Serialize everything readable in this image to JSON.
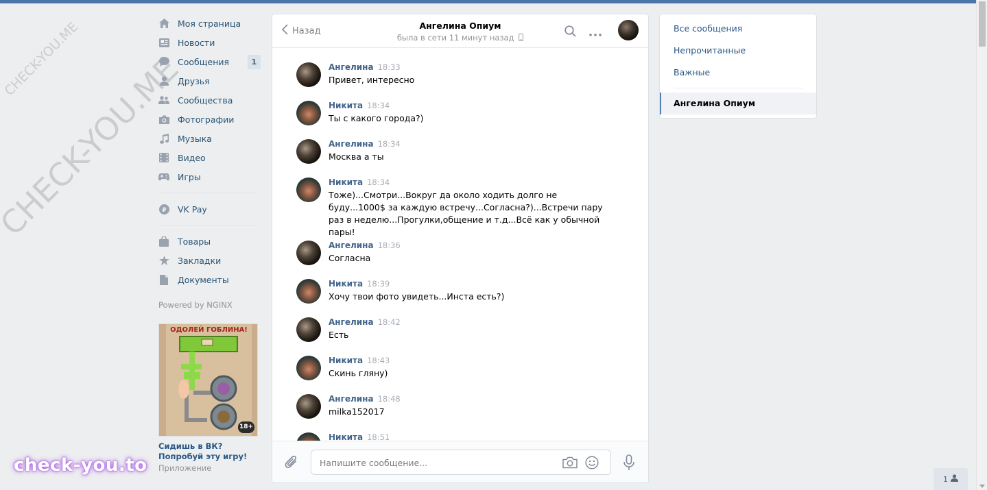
{
  "watermarks": {
    "small": "CHECK-YOU.ME",
    "big": "CHECK-YOU.ME",
    "bottom": "check-you.to"
  },
  "nav": {
    "items": [
      {
        "label": "Моя страница",
        "icon": "home-icon"
      },
      {
        "label": "Новости",
        "icon": "news-icon"
      },
      {
        "label": "Сообщения",
        "icon": "messages-icon",
        "badge": "1"
      },
      {
        "label": "Друзья",
        "icon": "friends-icon"
      },
      {
        "label": "Сообщества",
        "icon": "communities-icon"
      },
      {
        "label": "Фотографии",
        "icon": "camera-icon"
      },
      {
        "label": "Музыка",
        "icon": "music-icon"
      },
      {
        "label": "Видео",
        "icon": "video-icon"
      },
      {
        "label": "Игры",
        "icon": "gamepad-icon"
      }
    ],
    "vkpay": "VK Pay",
    "items2": [
      {
        "label": "Товары",
        "icon": "bag-icon"
      },
      {
        "label": "Закладки",
        "icon": "star-icon"
      },
      {
        "label": "Документы",
        "icon": "document-icon"
      }
    ],
    "powered": "Powered by NGINX",
    "ad": {
      "banner_text": "ОДОЛЕЙ ГОБЛИНА!",
      "age": "18+",
      "title": "Сидишь в ВК? Попробуй эту игру!",
      "subtitle": "Приложение"
    }
  },
  "chat": {
    "back_label": "Назад",
    "title": "Ангелина Опиум",
    "status": "была в сети 11 минут назад",
    "messages": [
      {
        "author": "Ангелина",
        "time": "18:33",
        "text": "Привет, интересно",
        "who": "a"
      },
      {
        "author": "Никита",
        "time": "18:34",
        "text": "Ты с какого города?)",
        "who": "n"
      },
      {
        "author": "Ангелина",
        "time": "18:34",
        "text": "Москва а ты",
        "who": "a"
      },
      {
        "author": "Никита",
        "time": "18:34",
        "text": "Тоже)...Смотри...Вокруг да около ходить долго не буду...1000$ за каждую встречу...Согласна?)...Встречи пару раз в неделю...Прогулки,общение и т.д...Всё как у обычной пары!",
        "who": "n"
      },
      {
        "author": "Ангелина",
        "time": "18:36",
        "text": "Согласна",
        "who": "a"
      },
      {
        "author": "Никита",
        "time": "18:39",
        "text": "Хочу твои фото увидеть...Инста есть?)",
        "who": "n"
      },
      {
        "author": "Ангелина",
        "time": "18:42",
        "text": "Есть",
        "who": "a"
      },
      {
        "author": "Никита",
        "time": "18:43",
        "text": "Скинь гляну)",
        "who": "n"
      },
      {
        "author": "Ангелина",
        "time": "18:48",
        "text": "milka152017",
        "who": "a"
      },
      {
        "author": "Никита",
        "time": "18:51",
        "text": "",
        "who": "n"
      }
    ],
    "composer_placeholder": "Напишите сообщение..."
  },
  "right_panel": {
    "all": "Все сообщения",
    "unread": "Непрочитанные",
    "important": "Важные",
    "active_chat": "Ангелина Опиум"
  },
  "bottom_button": {
    "count": "1"
  },
  "colors": {
    "accent": "#4a76a8",
    "link": "#2a5885",
    "author": "#42648b",
    "background": "#edeef0"
  }
}
